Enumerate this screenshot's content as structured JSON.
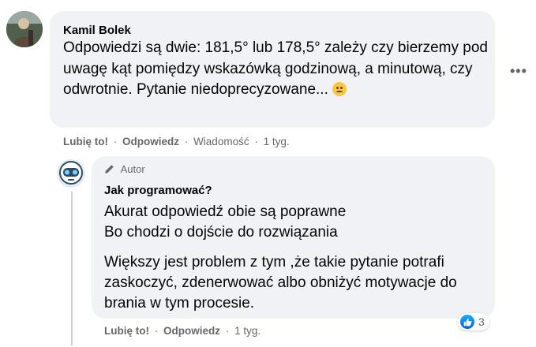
{
  "comment": {
    "author": "Kamil Bolek",
    "text": "Odpowiedzi są dwie: 181,5° lub 178,5° zależy czy bierzemy pod uwagę kąt pomiędzy wskazówką godzinową, a minutową, czy odwrotnie. Pytanie niedoprecyzowane...",
    "emoji": "frowning-face",
    "actions": {
      "like": "Lubię to!",
      "reply": "Odpowiedz",
      "message": "Wiadomość",
      "time": "1 tyg."
    },
    "more_icon": "horizontal-ellipsis",
    "more_label": "•••"
  },
  "reply": {
    "badge": "Autor",
    "badge_icon": "pencil-icon",
    "author": "Jak programować?",
    "paragraph1_line1": "Akurat odpowiedź obie są poprawne",
    "paragraph1_line2": "Bo chodzi o dojście do rozwiązania",
    "paragraph2": "Większy jest problem z tym ,że takie pytanie potrafi zaskoczyć, zdenerwować albo obniżyć motywacje do brania w tym procesie.",
    "actions": {
      "like": "Lubię to!",
      "reply": "Odpowiedz",
      "time": "1 tyg."
    },
    "reaction_count": "3",
    "reaction_icon": "like-icon"
  },
  "colors": {
    "bubble": "#f0f2f5",
    "secondary_text": "#65676b",
    "like_blue": "#1877f2"
  }
}
